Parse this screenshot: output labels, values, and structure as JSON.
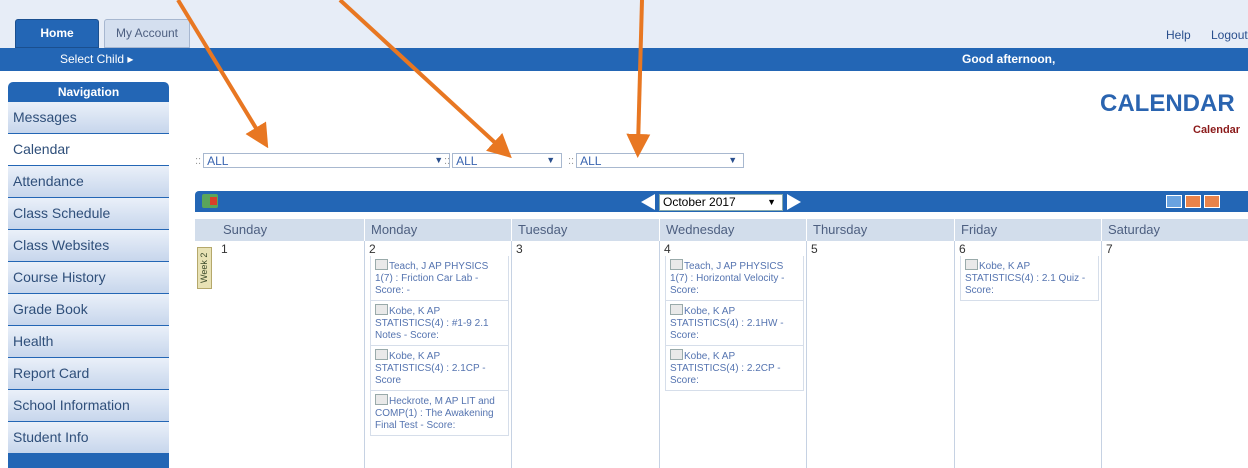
{
  "tabs": {
    "home": "Home",
    "my_account": "My Account"
  },
  "top_links": {
    "help": "Help",
    "logout": "Logout"
  },
  "bar": {
    "select_child": "Select Child ▸",
    "greeting": "Good afternoon,"
  },
  "sidebar": {
    "heading": "Navigation",
    "items": [
      {
        "label": "Messages"
      },
      {
        "label": "Calendar"
      },
      {
        "label": "Attendance"
      },
      {
        "label": "Class Schedule"
      },
      {
        "label": "Class Websites"
      },
      {
        "label": "Course History"
      },
      {
        "label": "Grade Book"
      },
      {
        "label": "Health"
      },
      {
        "label": "Report Card"
      },
      {
        "label": "School Information"
      },
      {
        "label": "Student Info"
      }
    ],
    "active": "Calendar"
  },
  "header": {
    "title": "CALENDAR",
    "subtitle": "Calendar"
  },
  "filters": {
    "separator": "::",
    "filter1": "ALL",
    "filter2": "ALL",
    "filter3": "ALL"
  },
  "calendar": {
    "month": "October 2017",
    "week_label": "Week 2",
    "days": [
      "Sunday",
      "Monday",
      "Tuesday",
      "Wednesday",
      "Thursday",
      "Friday",
      "Saturday"
    ],
    "dates": [
      "1",
      "2",
      "3",
      "4",
      "5",
      "6",
      "7"
    ],
    "events": {
      "monday": [
        "Teach, J AP PHYSICS 1(7) : Friction Car Lab - Score: -",
        "Kobe, K AP STATISTICS(4) : #1-9 2.1 Notes - Score:",
        "Kobe, K AP STATISTICS(4) : 2.1CP - Score",
        "Heckrote, M AP LIT and COMP(1) : The Awakening Final Test - Score:"
      ],
      "wednesday": [
        "Teach, J AP PHYSICS 1(7) : Horizontal Velocity - Score:",
        "Kobe, K AP STATISTICS(4) : 2.1HW - Score:",
        "Kobe, K AP STATISTICS(4) : 2.2CP - Score:"
      ],
      "friday": [
        "Kobe, K AP STATISTICS(4) : 2.1 Quiz - Score:"
      ]
    }
  },
  "colors": {
    "brand_blue": "#2366b5",
    "annotation_arrow": "#e87722"
  }
}
